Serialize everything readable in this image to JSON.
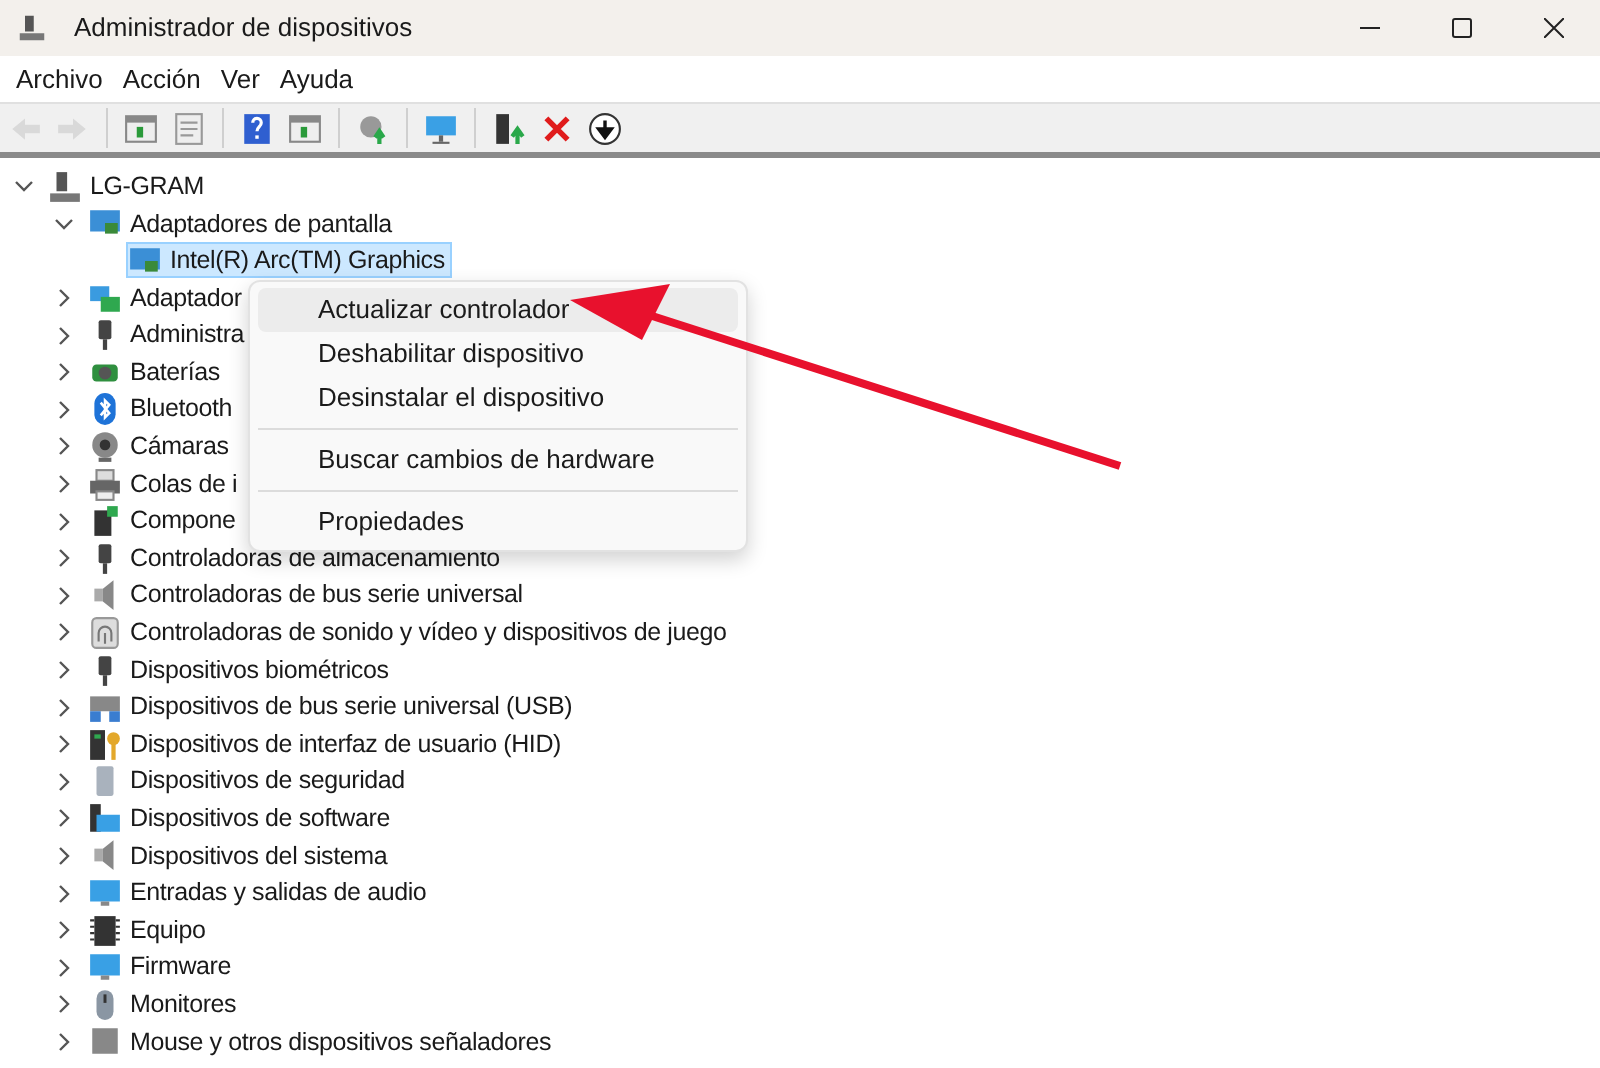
{
  "window": {
    "title": "Administrador de dispositivos"
  },
  "menu_bar": [
    "Archivo",
    "Acción",
    "Ver",
    "Ayuda"
  ],
  "toolbar": [
    {
      "kind": "button",
      "disabled": true
    },
    {
      "kind": "button",
      "disabled": true
    },
    {
      "kind": "separator"
    },
    {
      "kind": "button",
      "disabled": false
    },
    {
      "kind": "button",
      "disabled": false
    },
    {
      "kind": "separator"
    },
    {
      "kind": "button",
      "disabled": false
    },
    {
      "kind": "button",
      "disabled": false
    },
    {
      "kind": "separator"
    },
    {
      "kind": "button",
      "disabled": false
    },
    {
      "kind": "separator"
    },
    {
      "kind": "button",
      "disabled": false
    },
    {
      "kind": "separator"
    },
    {
      "kind": "button",
      "disabled": false
    },
    {
      "kind": "button",
      "disabled": false
    },
    {
      "kind": "button",
      "disabled": false
    }
  ],
  "tree": [
    {
      "label": "LG-GRAM",
      "expanded": true,
      "selected": false,
      "children": [
        {
          "label": "Adaptadores de pantalla",
          "expanded": true,
          "selected": false,
          "children": [
            {
              "label": "Intel(R) Arc(TM) Graphics",
              "selected": true
            }
          ]
        },
        {
          "label": "Adaptador",
          "expanded": false,
          "selected": false
        },
        {
          "label": "Administra",
          "expanded": false,
          "selected": false
        },
        {
          "label": "Baterías",
          "expanded": false,
          "selected": false
        },
        {
          "label": "Bluetooth",
          "expanded": false,
          "selected": false
        },
        {
          "label": "Cámaras",
          "expanded": false,
          "selected": false
        },
        {
          "label": "Colas de i",
          "expanded": false,
          "selected": false
        },
        {
          "label": "Compone",
          "expanded": false,
          "selected": false
        },
        {
          "label": "Controladoras de almacenamiento",
          "expanded": false,
          "selected": false
        },
        {
          "label": "Controladoras de bus serie universal",
          "expanded": false,
          "selected": false
        },
        {
          "label": "Controladoras de sonido y vídeo y dispositivos de juego",
          "expanded": false,
          "selected": false
        },
        {
          "label": "Dispositivos biométricos",
          "expanded": false,
          "selected": false
        },
        {
          "label": "Dispositivos de bus serie universal (USB)",
          "expanded": false,
          "selected": false
        },
        {
          "label": "Dispositivos de interfaz de usuario (HID)",
          "expanded": false,
          "selected": false
        },
        {
          "label": "Dispositivos de seguridad",
          "expanded": false,
          "selected": false
        },
        {
          "label": "Dispositivos de software",
          "expanded": false,
          "selected": false
        },
        {
          "label": "Dispositivos del sistema",
          "expanded": false,
          "selected": false
        },
        {
          "label": "Entradas y salidas de audio",
          "expanded": false,
          "selected": false
        },
        {
          "label": "Equipo",
          "expanded": false,
          "selected": false
        },
        {
          "label": "Firmware",
          "expanded": false,
          "selected": false
        },
        {
          "label": "Monitores",
          "expanded": false,
          "selected": false
        },
        {
          "label": "Mouse y otros dispositivos señaladores",
          "expanded": false,
          "selected": false
        }
      ]
    }
  ],
  "context_menu": [
    {
      "kind": "item",
      "label": "Actualizar controlador",
      "selected": true
    },
    {
      "kind": "item",
      "label": "Deshabilitar dispositivo",
      "selected": false
    },
    {
      "kind": "item",
      "label": "Desinstalar el dispositivo",
      "selected": false
    },
    {
      "kind": "separator"
    },
    {
      "kind": "item",
      "label": "Buscar cambios de hardware",
      "selected": false
    },
    {
      "kind": "separator"
    },
    {
      "kind": "item",
      "label": "Propiedades",
      "selected": false
    }
  ]
}
